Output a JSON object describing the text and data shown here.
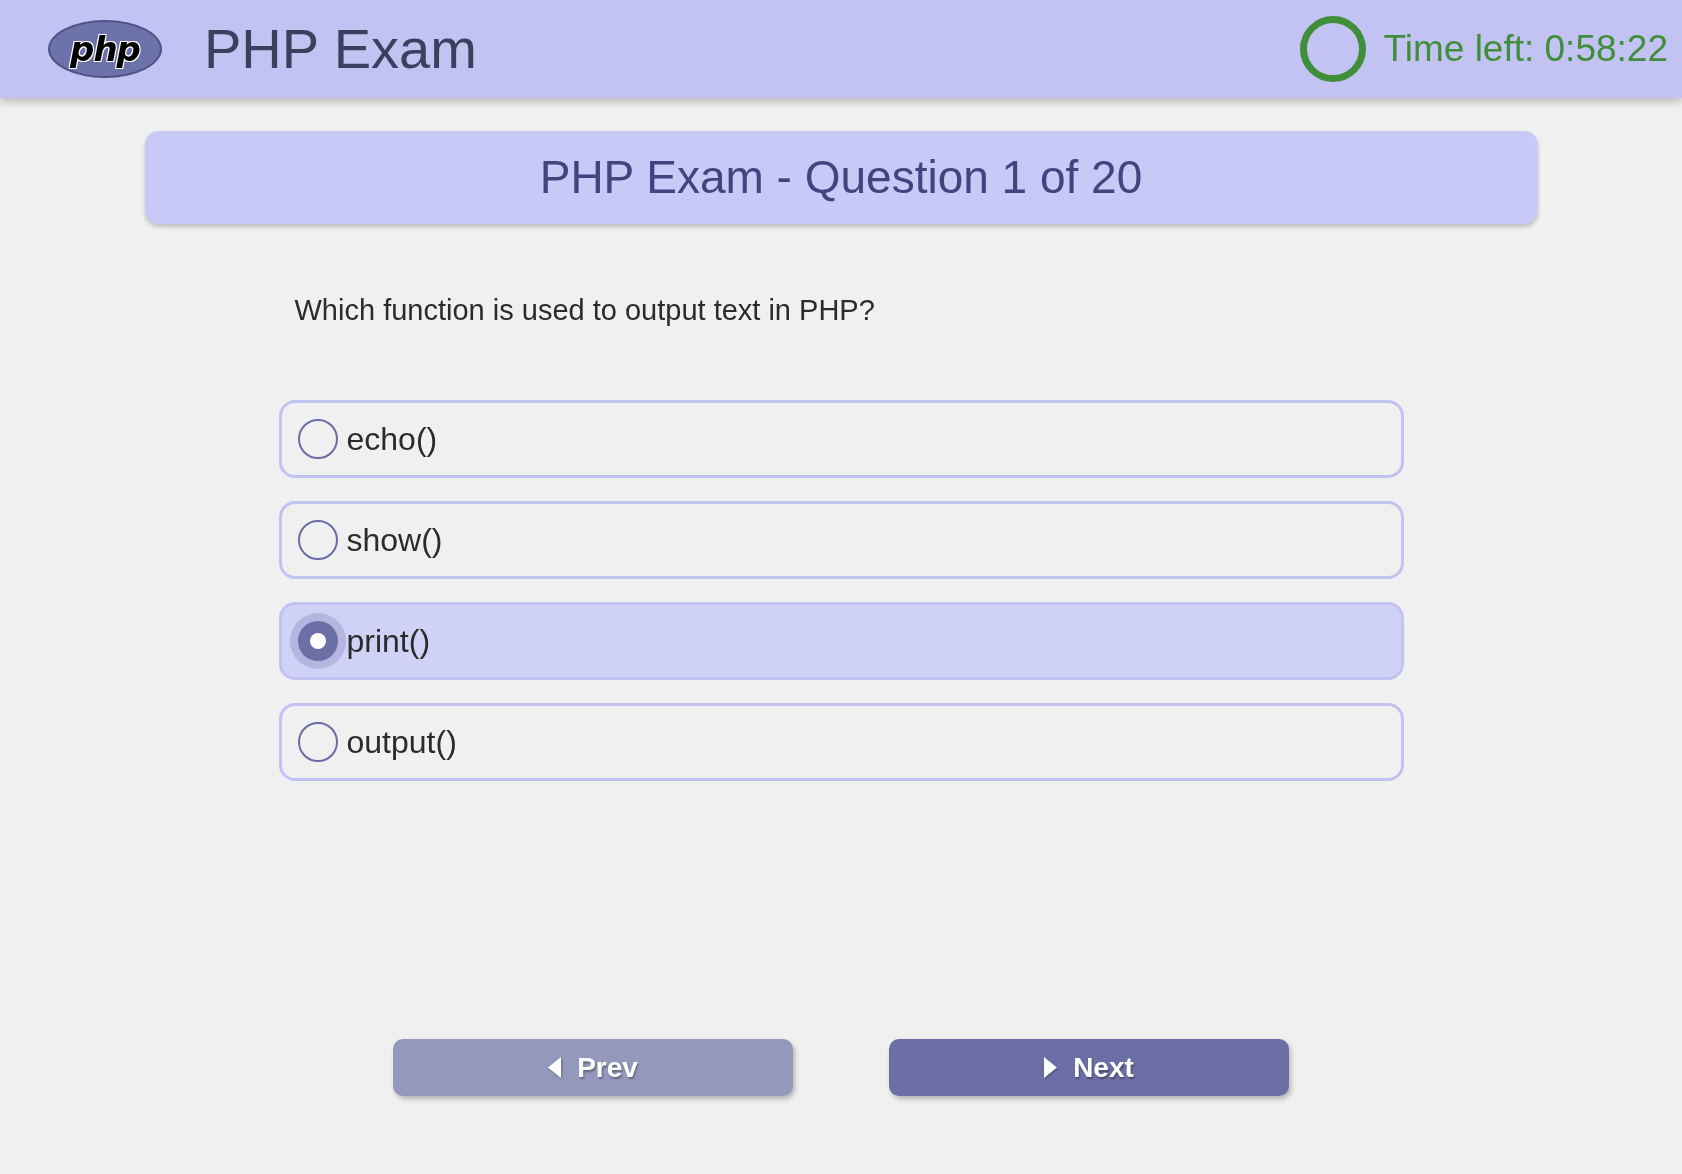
{
  "header": {
    "logo": "php",
    "title": "PHP Exam",
    "timer": "Time left: 0:58:22"
  },
  "question_card": {
    "title": "PHP Exam - Question 1 of 20"
  },
  "question": {
    "text": "Which function is used to output text in PHP?",
    "options": [
      {
        "label": "echo()",
        "selected": false
      },
      {
        "label": "show()",
        "selected": false
      },
      {
        "label": "print()",
        "selected": true
      },
      {
        "label": "output()",
        "selected": false
      }
    ]
  },
  "navigation": [
    {
      "kind": "prev",
      "label": "Prev",
      "disabled": true
    },
    {
      "kind": "next",
      "label": "Next",
      "disabled": false
    }
  ]
}
